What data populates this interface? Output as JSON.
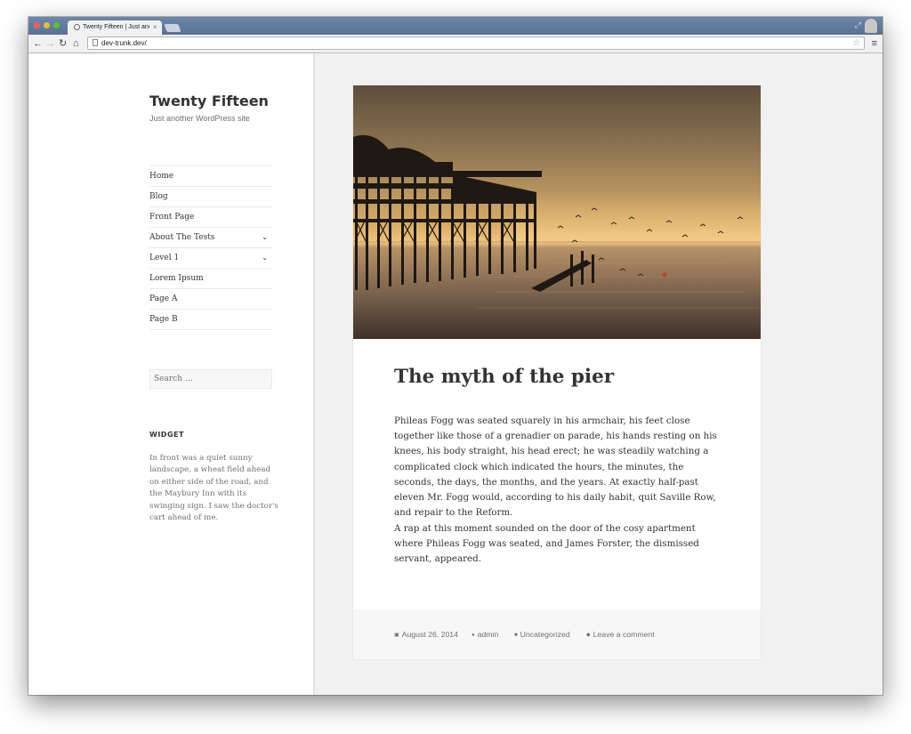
{
  "browser": {
    "tab_title": "Twenty Fifteen | Just another WordPress site",
    "tab_close": "×",
    "url": "dev-trunk.dev/"
  },
  "site": {
    "title": "Twenty Fifteen",
    "description": "Just another WordPress site"
  },
  "nav": {
    "items": [
      {
        "label": "Home",
        "has_submenu": false
      },
      {
        "label": "Blog",
        "has_submenu": false
      },
      {
        "label": "Front Page",
        "has_submenu": false
      },
      {
        "label": "About The Tests",
        "has_submenu": true
      },
      {
        "label": "Level 1",
        "has_submenu": true
      },
      {
        "label": "Lorem Ipsum",
        "has_submenu": false
      },
      {
        "label": "Page A",
        "has_submenu": false
      },
      {
        "label": "Page B",
        "has_submenu": false
      }
    ]
  },
  "search": {
    "placeholder": "Search …"
  },
  "widget": {
    "title": "WIDGET",
    "text": "In front was a quiet sunny landscape, a wheat field ahead on either side of the road, and the Maybury Inn with its swinging sign. I saw the doctor's cart ahead of me."
  },
  "post": {
    "title": "The myth of the pier",
    "paragraphs": [
      "Phileas Fogg was seated squarely in his armchair, his feet close together like those of a grenadier on parade, his hands resting on his knees, his body straight, his head erect; he was steadily watching a complicated clock which indicated the hours, the minutes, the seconds, the days, the months, and the years. At exactly half-past eleven Mr. Fogg would, according to his daily habit, quit Saville Row, and repair to the Reform.",
      "A rap at this moment sounded on the door of the cosy apartment where Phileas Fogg was seated, and James Forster, the dismissed servant, appeared."
    ],
    "date": "August 26, 2014",
    "author": "admin",
    "category": "Uncategorized",
    "comment_link": "Leave a comment"
  },
  "icons": {
    "nav_back": "arrow-left-icon",
    "nav_forward": "arrow-right-icon",
    "reload": "reload-icon",
    "home": "home-icon",
    "bookmark": "star-icon",
    "menu": "hamburger-menu-icon",
    "submenu": "chevron-down-icon",
    "date": "calendar-icon",
    "author": "person-icon",
    "category": "folder-icon",
    "comment": "speech-bubble-icon"
  },
  "colors": {
    "text": "#333333",
    "muted": "#707070",
    "page_bg": "#f1f1f1",
    "titlebar": "#5a7194"
  }
}
